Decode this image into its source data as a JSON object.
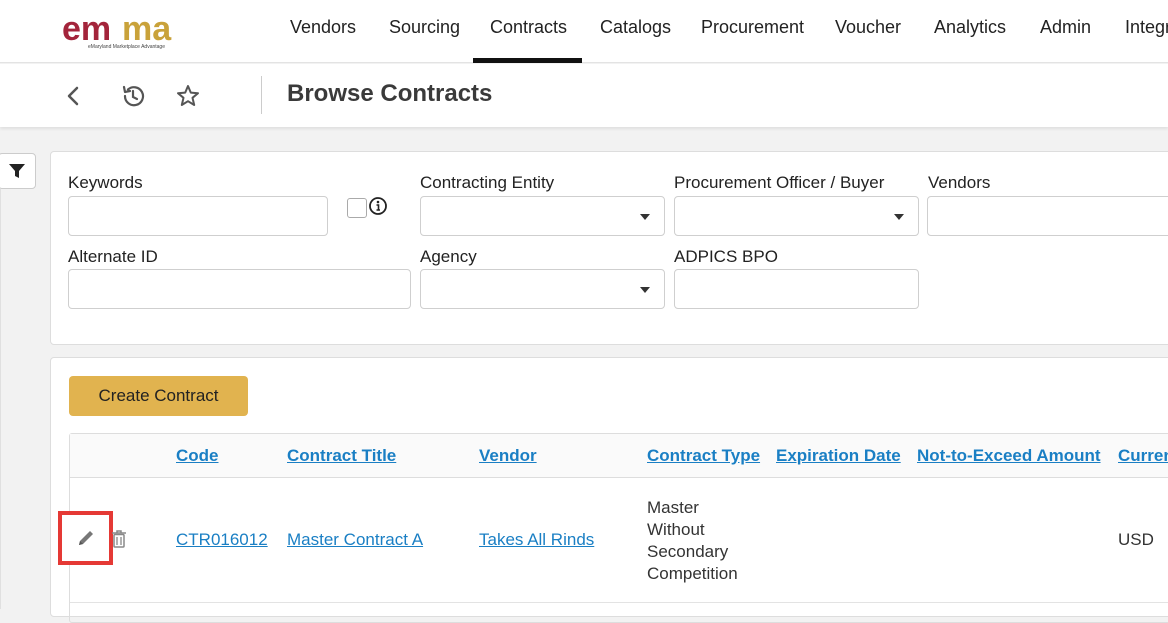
{
  "brand": {
    "logo_text": "emma",
    "logo_tagline": "eMaryland Marketplace Advantage"
  },
  "nav": {
    "items": [
      "Vendors",
      "Sourcing",
      "Contracts",
      "Catalogs",
      "Procurement",
      "Voucher",
      "Analytics",
      "Admin",
      "Integr"
    ],
    "active": "Contracts"
  },
  "subbar": {
    "title": "Browse Contracts"
  },
  "filters": {
    "keywords_label": "Keywords",
    "contracting_entity_label": "Contracting Entity",
    "procurement_officer_label": "Procurement Officer / Buyer",
    "vendors_label": "Vendors",
    "alternate_id_label": "Alternate ID",
    "agency_label": "Agency",
    "adpics_label": "ADPICS BPO"
  },
  "results": {
    "create_label": "Create Contract",
    "columns": [
      "Code",
      "Contract Title",
      "Vendor",
      "Contract Type",
      "Expiration Date",
      "Not-to-Exceed Amount",
      "Curren"
    ],
    "rows": [
      {
        "code": "CTR016012",
        "title": "Master Contract A",
        "vendor": "Takes All Rinds",
        "type_lines": [
          "Master",
          "Without",
          "Secondary",
          "Competition"
        ],
        "expiration": "",
        "nte": "",
        "currency": "USD"
      }
    ]
  },
  "colors": {
    "accent": "#e1b34f",
    "link": "#1a7fc4",
    "highlight": "#e53935"
  }
}
